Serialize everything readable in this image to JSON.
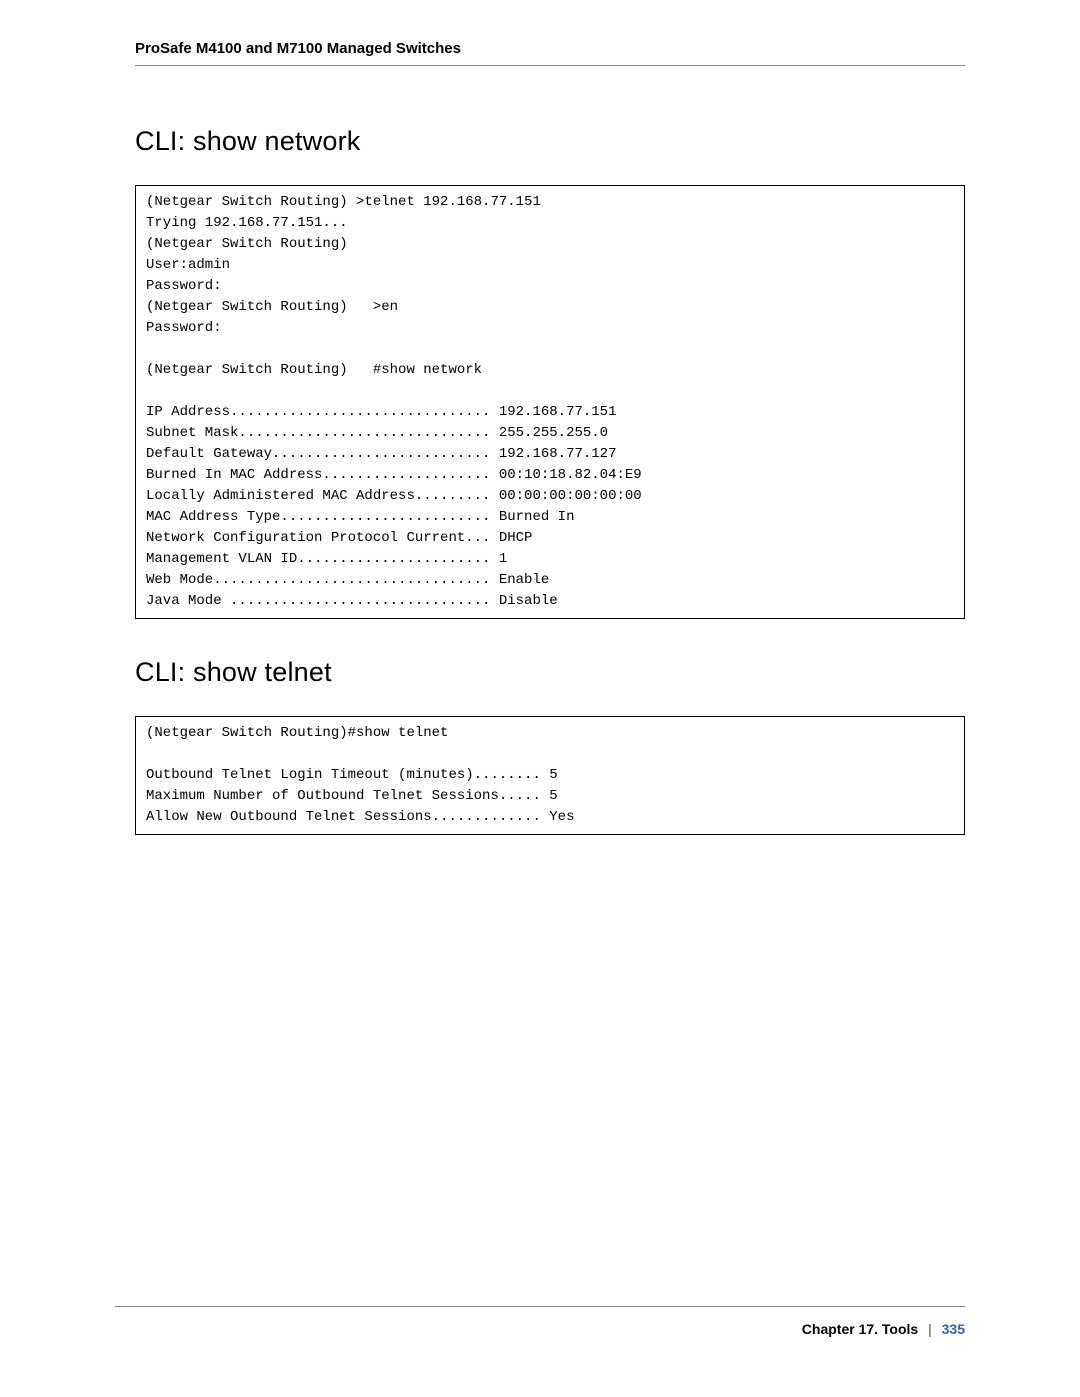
{
  "header": {
    "title": "ProSafe M4100 and M7100 Managed Switches"
  },
  "sections": {
    "showNetwork": {
      "heading": "CLI: show network",
      "code": "(Netgear Switch Routing) >telnet 192.168.77.151\nTrying 192.168.77.151...\n(Netgear Switch Routing)\nUser:admin\nPassword:\n(Netgear Switch Routing)   >en\nPassword:\n\n(Netgear Switch Routing)   #show network\n\nIP Address............................... 192.168.77.151\nSubnet Mask.............................. 255.255.255.0\nDefault Gateway.......................... 192.168.77.127\nBurned In MAC Address.................... 00:10:18.82.04:E9\nLocally Administered MAC Address......... 00:00:00:00:00:00\nMAC Address Type......................... Burned In\nNetwork Configuration Protocol Current... DHCP\nManagement VLAN ID....................... 1\nWeb Mode................................. Enable\nJava Mode ............................... Disable"
    },
    "showTelnet": {
      "heading": "CLI: show telnet",
      "code": "(Netgear Switch Routing)#show telnet\n\nOutbound Telnet Login Timeout (minutes)........ 5\nMaximum Number of Outbound Telnet Sessions..... 5\nAllow New Outbound Telnet Sessions............. Yes"
    }
  },
  "footer": {
    "chapter": "Chapter 17.  Tools",
    "separator": "|",
    "pageNumber": "335"
  }
}
